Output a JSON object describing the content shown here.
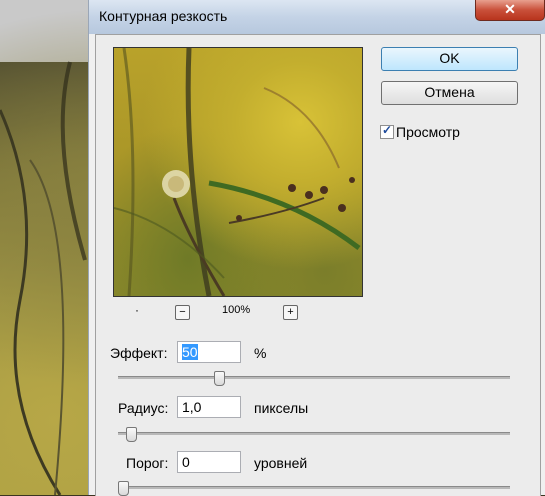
{
  "dialog": {
    "title": "Контурная резкость",
    "close_symbol": "✕"
  },
  "buttons": {
    "ok_label": "OK",
    "cancel_label": "Отмена"
  },
  "preview_toggle": {
    "label": "Просмотр",
    "checked": true
  },
  "zoom": {
    "minus": "−",
    "plus": "+",
    "level": "100%",
    "marker": "·"
  },
  "fields": {
    "amount": {
      "label": "Эффект:",
      "value": "50",
      "unit": "%",
      "slider_fraction": 0.25
    },
    "radius": {
      "label": "Радиус:",
      "value": "1,0",
      "unit": "пикселы",
      "slider_fraction": 0.02
    },
    "threshold": {
      "label": "Порог:",
      "value": "0",
      "unit": "уровней",
      "slider_fraction": 0.0
    }
  },
  "colors": {
    "accent": "#3399ff",
    "close_red": "#c9503a"
  }
}
